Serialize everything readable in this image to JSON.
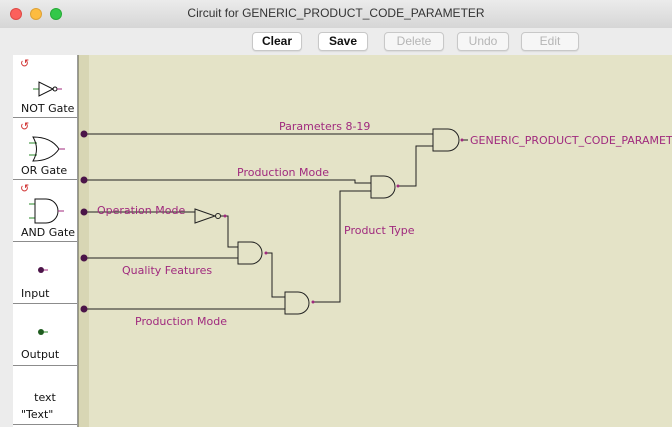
{
  "window": {
    "title": "Circuit for GENERIC_PRODUCT_CODE_PARAMETER"
  },
  "toolbar": {
    "clear": "Clear",
    "save": "Save",
    "delete": "Delete",
    "undo": "Undo",
    "edit": "Edit"
  },
  "palette": {
    "rotate_glyph": "↺",
    "not_gate": "NOT Gate",
    "or_gate": "OR Gate",
    "and_gate": "AND Gate",
    "input": "Input",
    "output": "Output",
    "text_sample": "text",
    "text_label": "\"Text\""
  },
  "circuit": {
    "inputs": [
      "Parameters 8-19",
      "Production Mode",
      "Operation Mode",
      "Quality Features",
      "Production Mode"
    ],
    "intermediate_label": "Product Type",
    "output_label": "GENERIC_PRODUCT_CODE_PARAMETER"
  },
  "colors": {
    "wire": "#222222",
    "label": "#a02a7e",
    "pin": "#4b1448",
    "canvas": "#e4e3c7"
  }
}
